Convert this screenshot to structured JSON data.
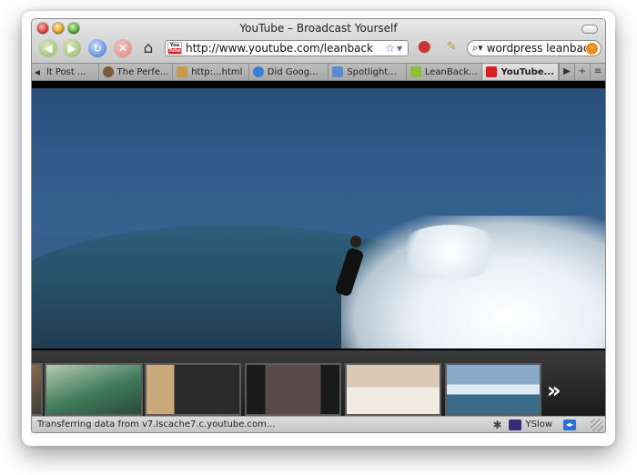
{
  "window": {
    "title": "YouTube – Broadcast Yourself"
  },
  "toolbar": {
    "back_icon": "back-arrow-icon",
    "forward_icon": "forward-arrow-icon",
    "reload_icon": "reload-icon",
    "stop_icon": "stop-icon",
    "home_icon": "home-icon"
  },
  "urlbar": {
    "url": "http://www.youtube.com/leanback",
    "favicon": "youtube-favicon"
  },
  "search": {
    "query": "wordpress leanback"
  },
  "tabs": [
    {
      "label": "lt Post ...",
      "color": "#d8d8d8"
    },
    {
      "label": "The Perfe...",
      "color": "#7a5a3a"
    },
    {
      "label": "http:...html",
      "color": "#c99a4a"
    },
    {
      "label": "Did Goog...",
      "color": "#3a7fd1"
    },
    {
      "label": "Spotlight...",
      "color": "#5a8ad1"
    },
    {
      "label": "LeanBack...",
      "color": "#8bbf3a"
    },
    {
      "label": "YouTube...",
      "color": "#d22222",
      "active": true
    }
  ],
  "thumbnails": [
    {
      "name": "partial",
      "colors": [
        "#8b6d4a",
        "#3a3a3a"
      ]
    },
    {
      "name": "surf-wave",
      "colors": [
        "#3f7a5a",
        "#b5c9b5"
      ]
    },
    {
      "name": "man-closeup",
      "colors": [
        "#8a5a3a",
        "#2a2a2a"
      ]
    },
    {
      "name": "man-portrait",
      "colors": [
        "#5a4a4a",
        "#c9c9c9"
      ]
    },
    {
      "name": "interview",
      "colors": [
        "#d9c9b5",
        "#5a6a7a"
      ]
    },
    {
      "name": "ocean-wave",
      "colors": [
        "#8aaac9",
        "#dfe9f2"
      ]
    }
  ],
  "status": {
    "text": "Transferring data from v7.lscache7.c.youtube.com...",
    "yslow_label": "YSlow"
  }
}
